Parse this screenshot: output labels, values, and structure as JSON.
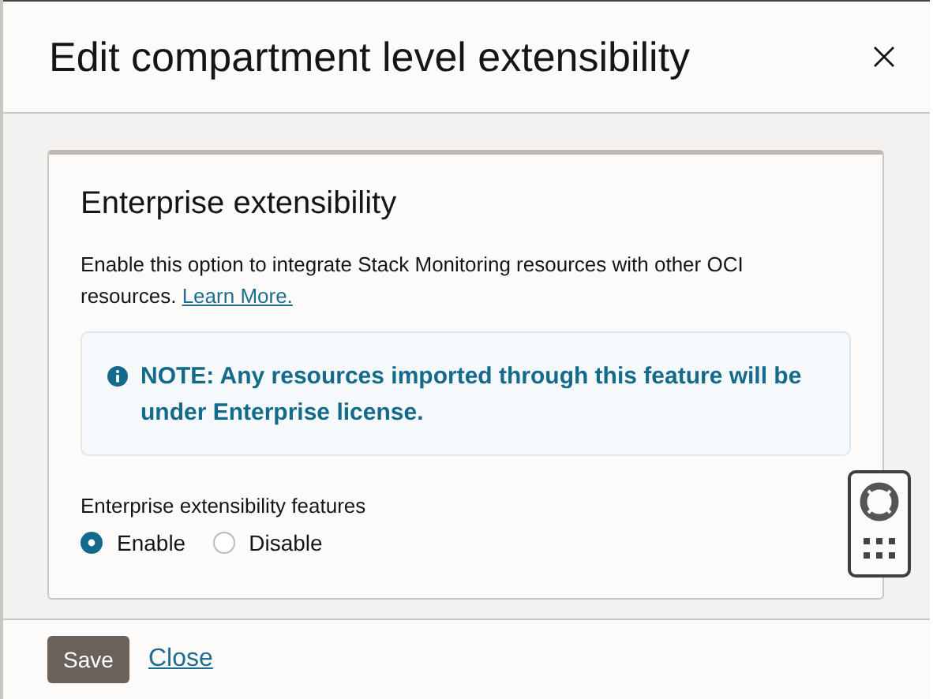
{
  "dialog": {
    "title": "Edit compartment level extensibility"
  },
  "card": {
    "heading": "Enterprise extensibility",
    "description": "Enable this option to integrate Stack Monitoring resources with other OCI resources.",
    "link": "Learn More.",
    "note": "NOTE: Any resources imported through this feature will be under Enterprise license.",
    "radio_group": {
      "label": "Enterprise extensibility features",
      "options": [
        {
          "label": "Enable",
          "selected": true
        },
        {
          "label": "Disable",
          "selected": false
        }
      ]
    }
  },
  "footer": {
    "primary": "Save",
    "link": "Close"
  }
}
